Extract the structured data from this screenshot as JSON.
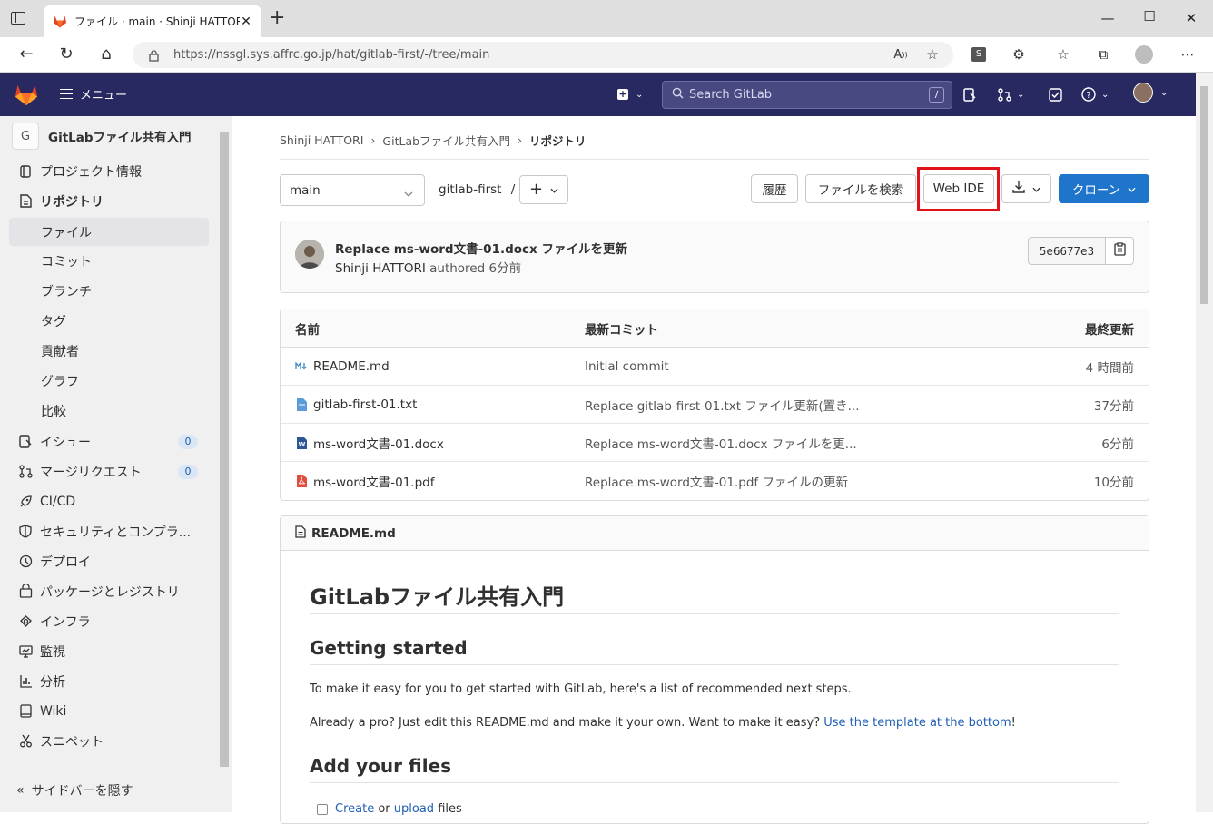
{
  "browser": {
    "tab_title": "ファイル · main · Shinji HATTORI / G",
    "url_host": "https://nssgl.sys.affrc.go.jp",
    "url_path": "/hat/gitlab-first/-/tree/main"
  },
  "topbar": {
    "menu_label": "メニュー",
    "search_placeholder": "Search GitLab",
    "search_shortcut": "/"
  },
  "sidebar": {
    "project_initial": "G",
    "project_name": "GitLabファイル共有入門",
    "items": [
      {
        "label": "プロジェクト情報",
        "icon": "info-icon"
      },
      {
        "label": "リポジトリ",
        "icon": "document-icon"
      },
      {
        "label": "ファイル"
      },
      {
        "label": "コミット"
      },
      {
        "label": "ブランチ"
      },
      {
        "label": "タグ"
      },
      {
        "label": "貢献者"
      },
      {
        "label": "グラフ"
      },
      {
        "label": "比較"
      },
      {
        "label": "イシュー",
        "icon": "issues-icon",
        "badge": "0"
      },
      {
        "label": "マージリクエスト",
        "icon": "merge-request-icon",
        "badge": "0"
      },
      {
        "label": "CI/CD",
        "icon": "rocket-icon"
      },
      {
        "label": "セキュリティとコンプラ...",
        "icon": "shield-icon"
      },
      {
        "label": "デプロイ",
        "icon": "deploy-icon"
      },
      {
        "label": "パッケージとレジストリ",
        "icon": "package-icon"
      },
      {
        "label": "インフラ",
        "icon": "cloud-icon"
      },
      {
        "label": "監視",
        "icon": "monitor-icon"
      },
      {
        "label": "分析",
        "icon": "chart-icon"
      },
      {
        "label": "Wiki",
        "icon": "book-icon"
      },
      {
        "label": "スニペット",
        "icon": "scissors-icon"
      }
    ],
    "collapse_label": "サイドバーを隠す"
  },
  "breadcrumb": {
    "owner": "Shinji HATTORI",
    "project": "GitLabファイル共有入門",
    "current": "リポジトリ"
  },
  "toolbar": {
    "branch": "main",
    "path": "gitlab-first",
    "path_sep": "/",
    "history": "履歴",
    "find_file": "ファイルを検索",
    "web_ide": "Web IDE",
    "clone": "クローン"
  },
  "last_commit": {
    "title": "Replace ms-word文書-01.docx ファイルを更新",
    "author": "Shinji HATTORI",
    "authored": "authored",
    "time": "6分前",
    "sha": "5e6677e3"
  },
  "files": {
    "headers": {
      "name": "名前",
      "commit": "最新コミット",
      "updated": "最終更新"
    },
    "rows": [
      {
        "name": "README.md",
        "icon": "markdown-icon",
        "commit": "Initial commit",
        "updated": "4 時間前"
      },
      {
        "name": "gitlab-first-01.txt",
        "icon": "text-file-icon",
        "commit": "Replace gitlab-first-01.txt ファイル更新(置き...",
        "updated": "37分前"
      },
      {
        "name": "ms-word文書-01.docx",
        "icon": "word-file-icon",
        "commit": "Replace ms-word文書-01.docx ファイルを更...",
        "updated": "6分前"
      },
      {
        "name": "ms-word文書-01.pdf",
        "icon": "pdf-file-icon",
        "commit": "Replace ms-word文書-01.pdf ファイルの更新",
        "updated": "10分前"
      }
    ]
  },
  "readme": {
    "filename": "README.md",
    "h1": "GitLabファイル共有入門",
    "h2_getting_started": "Getting started",
    "p1": "To make it easy for you to get started with GitLab, here's a list of recommended next steps.",
    "p2_prefix": "Already a pro? Just edit this README.md and make it your own. Want to make it easy? ",
    "p2_link": "Use the template at the bottom",
    "p2_suffix": "!",
    "h2_add_files": "Add your files",
    "check_create": "Create",
    "check_or": " or ",
    "check_upload": "upload",
    "check_files": " files"
  }
}
